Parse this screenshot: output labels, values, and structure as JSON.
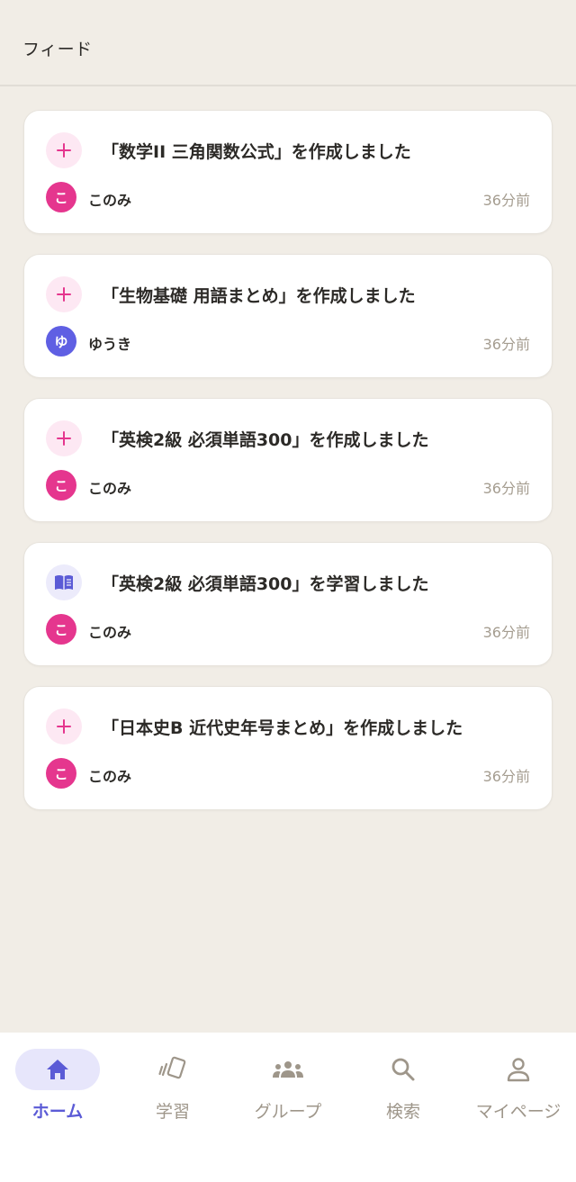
{
  "header": {
    "title": "フィード"
  },
  "feed": [
    {
      "type": "create",
      "icon": "plus-icon",
      "title": "「数学II 三角関数公式」を作成しました",
      "user": {
        "name": "このみ",
        "initial": "こ",
        "color": "#e5368e"
      },
      "time": "36分前"
    },
    {
      "type": "create",
      "icon": "plus-icon",
      "title": "「生物基礎 用語まとめ」を作成しました",
      "user": {
        "name": "ゆうき",
        "initial": "ゆ",
        "color": "#5f5fe3"
      },
      "time": "36分前"
    },
    {
      "type": "create",
      "icon": "plus-icon",
      "title": "「英検2級 必須単語300」を作成しました",
      "user": {
        "name": "このみ",
        "initial": "こ",
        "color": "#e5368e"
      },
      "time": "36分前"
    },
    {
      "type": "study",
      "icon": "book-icon",
      "title": "「英検2級 必須単語300」を学習しました",
      "user": {
        "name": "このみ",
        "initial": "こ",
        "color": "#e5368e"
      },
      "time": "36分前"
    },
    {
      "type": "create",
      "icon": "plus-icon",
      "title": "「日本史B 近代史年号まとめ」を作成しました",
      "user": {
        "name": "このみ",
        "initial": "こ",
        "color": "#e5368e"
      },
      "time": "36分前"
    }
  ],
  "nav": [
    {
      "label": "ホーム",
      "icon": "home-icon",
      "active": true
    },
    {
      "label": "学習",
      "icon": "cards-icon",
      "active": false
    },
    {
      "label": "グループ",
      "icon": "group-icon",
      "active": false
    },
    {
      "label": "検索",
      "icon": "search-icon",
      "active": false
    },
    {
      "label": "マイページ",
      "icon": "person-icon",
      "active": false
    }
  ],
  "colors": {
    "background": "#f1ede6",
    "accent": "#5b5bd6",
    "create_icon": "#e5368e",
    "muted_text": "#a59d90"
  }
}
